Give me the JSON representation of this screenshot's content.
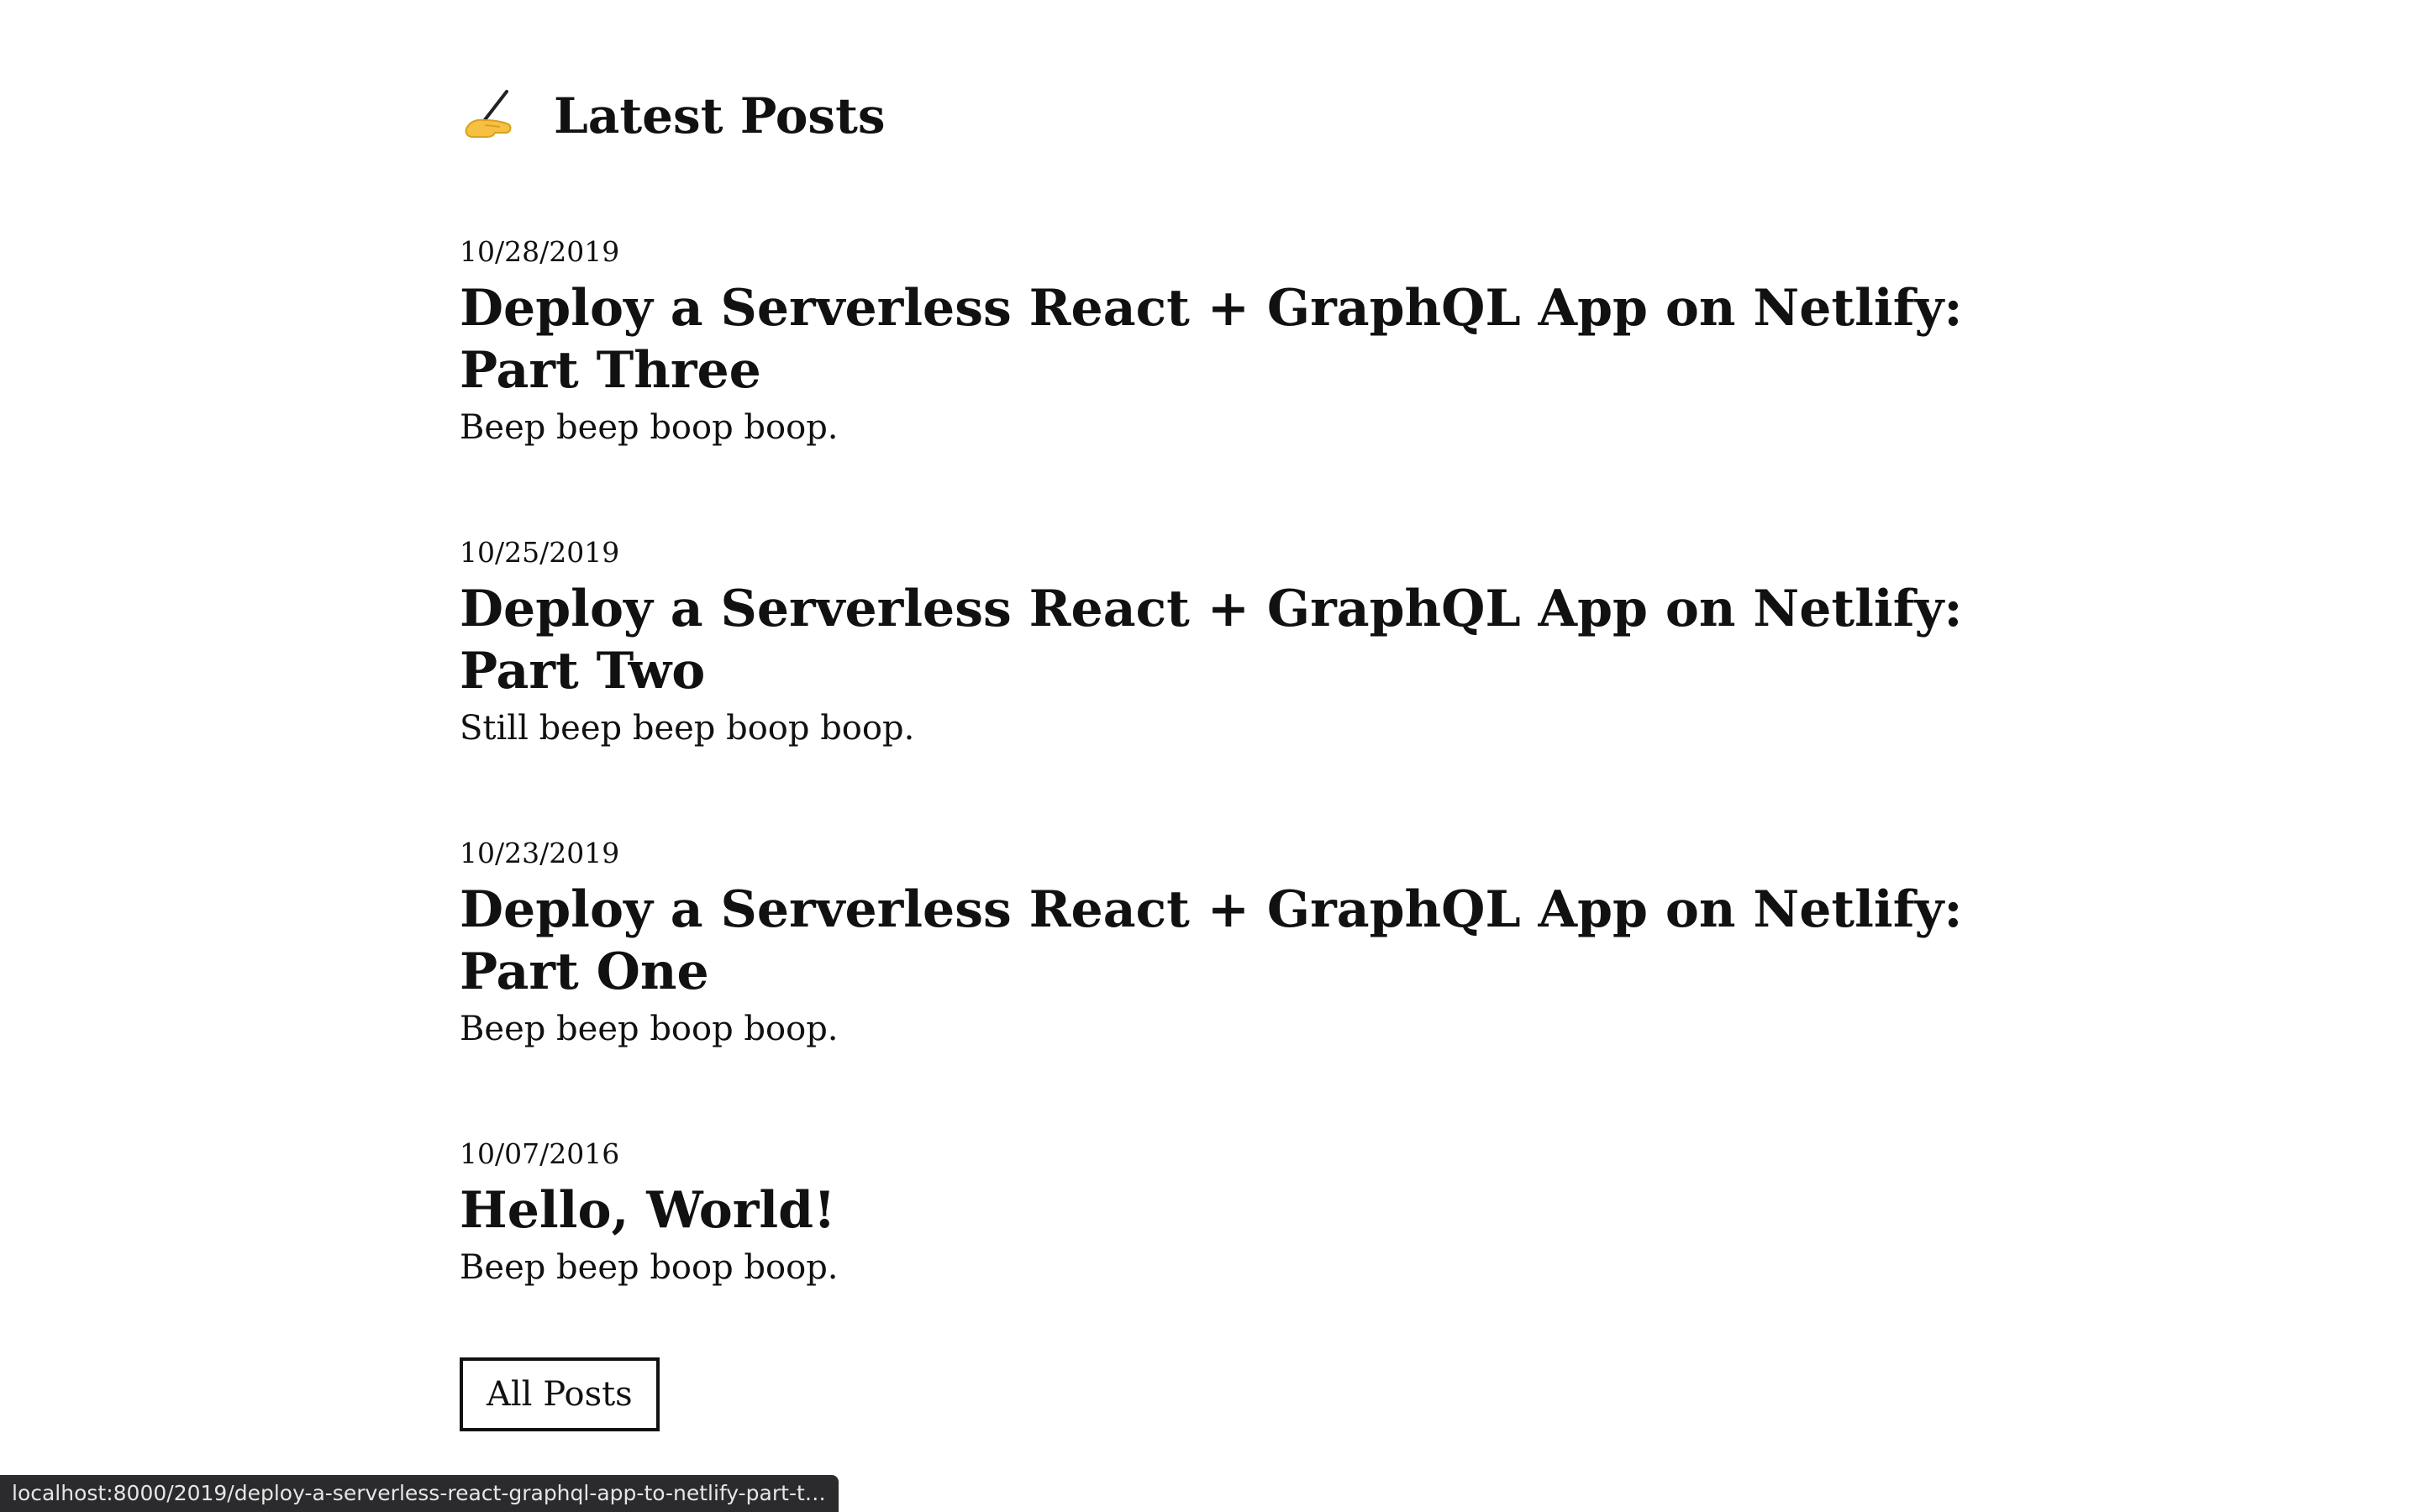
{
  "header": {
    "icon": "writing-hand-icon",
    "title": "Latest Posts"
  },
  "posts": [
    {
      "date": "10/28/2019",
      "title": "Deploy a Serverless React + GraphQL App on Netlify: Part Three",
      "excerpt": "Beep beep boop boop."
    },
    {
      "date": "10/25/2019",
      "title": "Deploy a Serverless React + GraphQL App on Netlify: Part Two",
      "excerpt": "Still beep beep boop boop."
    },
    {
      "date": "10/23/2019",
      "title": "Deploy a Serverless React + GraphQL App on Netlify: Part One",
      "excerpt": "Beep beep boop boop."
    },
    {
      "date": "10/07/2016",
      "title": "Hello, World!",
      "excerpt": "Beep beep boop boop."
    }
  ],
  "footer": {
    "all_posts_label": "All Posts"
  },
  "status_bar": {
    "url": "localhost:8000/2019/deploy-a-serverless-react-graphql-app-to-netlify-part-thr..."
  }
}
